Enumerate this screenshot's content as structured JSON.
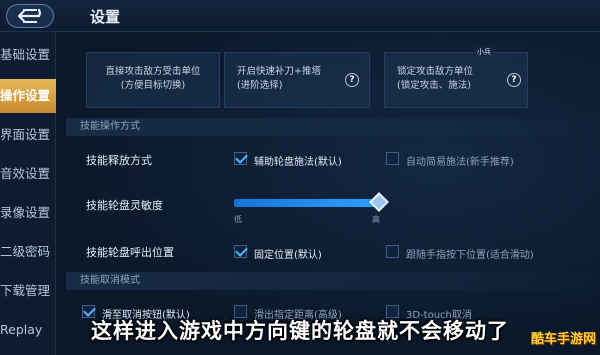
{
  "header": {
    "title": "设置",
    "back_icon": "back-arrow-icon"
  },
  "sidebar": {
    "items": [
      {
        "label": "基础设置"
      },
      {
        "label": "操作设置"
      },
      {
        "label": "界面设置"
      },
      {
        "label": "音效设置"
      },
      {
        "label": "录像设置"
      },
      {
        "label": "二级密码"
      },
      {
        "label": "下载管理"
      },
      {
        "label": "Replay"
      }
    ],
    "active_index": 1
  },
  "cards": [
    {
      "line1": "直接攻击敌方受击单位",
      "line2": "(方便目标切换)"
    },
    {
      "line1": "开启快速补刀+推塔",
      "line2": "(进阶选择)",
      "help": "?"
    },
    {
      "line1": "锁定攻击敌方单位",
      "line2": "(锁定攻击、施法)",
      "help": "?",
      "tag": "小兵"
    }
  ],
  "sections": {
    "skill_operation": "技能操作方式",
    "skill_cancel": "技能取消模式"
  },
  "rows": {
    "cast_mode": {
      "label": "技能释放方式",
      "option1": "辅助轮盘施法(默认)",
      "option1_checked": true,
      "option2": "自动简易施法(新手推荐)",
      "option2_checked": false
    },
    "sensitivity": {
      "label": "技能轮盘灵敏度",
      "low": "低",
      "high": "高",
      "value_fraction": 1.0
    },
    "wheel_position": {
      "label": "技能轮盘呼出位置",
      "option1": "固定位置(默认)",
      "option1_checked": true,
      "option2": "跟随手指按下位置(适合滑动)",
      "option2_checked": false
    },
    "cancel_mode": {
      "option1": "滑至取消按钮(默认)",
      "option1_checked": true,
      "option2": "滑出指定距离(高级)",
      "option2_checked": false,
      "option3": "3D-touch取消",
      "option3_checked": false
    }
  },
  "overlay": {
    "subtitle": "这样进入游戏中方向键的轮盘就不会移动了",
    "watermark": "酷车手游网"
  }
}
